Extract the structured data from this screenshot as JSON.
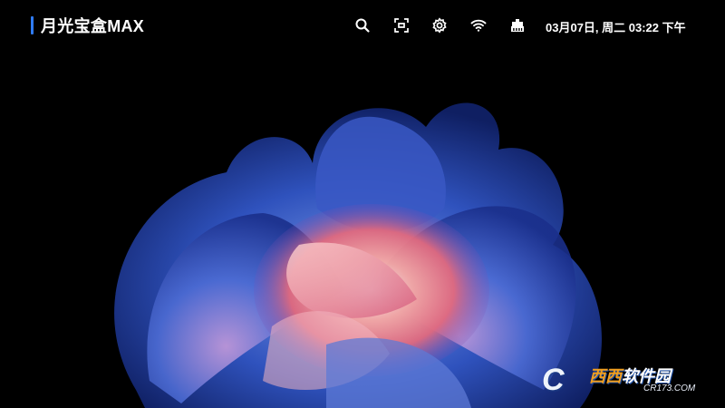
{
  "app": {
    "title": "月光宝盒MAX",
    "accent_color": "#2f7bf6"
  },
  "status_bar": {
    "icons": [
      "search-icon",
      "screen-scan-icon",
      "settings-gear-icon",
      "wifi-icon",
      "ethernet-icon"
    ],
    "datetime": "03月07日, 周二 03:22 下午"
  },
  "wallpaper": {
    "subject": "abstract flower",
    "colors": [
      "#000000",
      "#1c3a9a",
      "#ec7c86",
      "#f7d9d8"
    ]
  },
  "watermark": {
    "logo_letter": "C",
    "name_highlight": "西西",
    "name_rest": "软件园",
    "url": "CR173.COM"
  }
}
